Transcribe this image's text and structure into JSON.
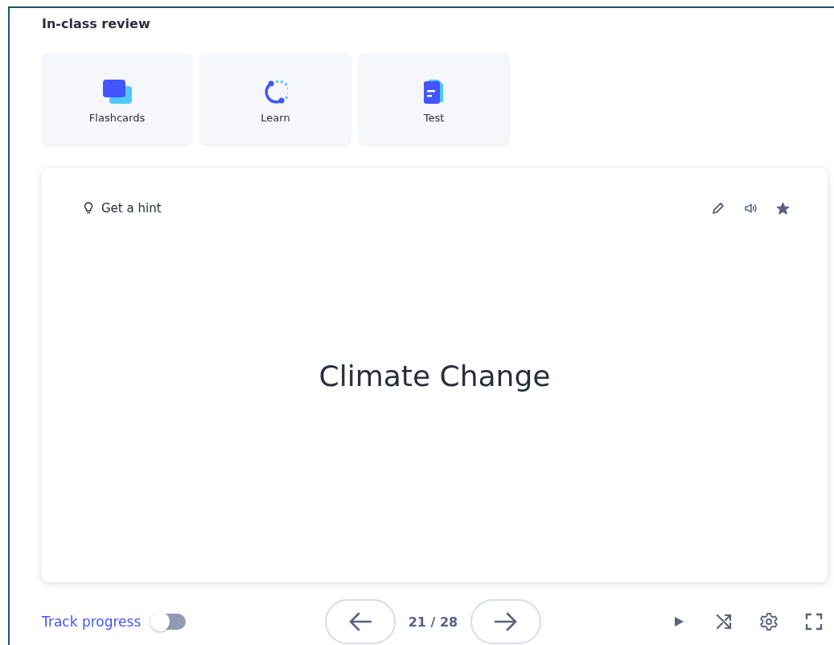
{
  "section_title": "In-class review",
  "modes": [
    {
      "kind": "flashcards",
      "label": "Flashcards"
    },
    {
      "kind": "learn",
      "label": "Learn"
    },
    {
      "kind": "test",
      "label": "Test"
    }
  ],
  "card": {
    "hint": "Get a hint",
    "term": "Climate Change",
    "starred": true
  },
  "footer": {
    "track_progress": {
      "label": "Track progress",
      "on": false
    },
    "counter": "21 / 28"
  }
}
